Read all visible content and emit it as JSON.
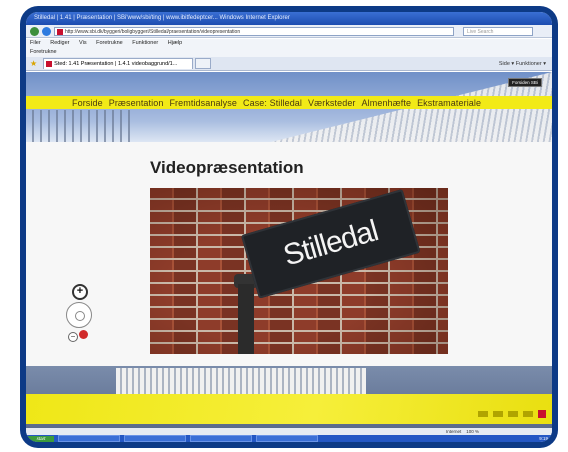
{
  "browser": {
    "title": "Stilledal | 1.41 | Præsentation | SBi'www/sbi/ting | www.ibitfedeptcer... Windows Internet Explorer",
    "address": "http://www.sbi.dk/byggeri/boligbyggeri/Stilledal/praesentation/videopresentation",
    "search_placeholder": "Live Search",
    "menu": [
      "Filer",
      "Rediger",
      "Vis",
      "Foretrukne",
      "Funktioner",
      "Hjælp"
    ],
    "favorites": "Foretrukne",
    "tab_label": "Sted: 1.41 Præsentation | 1.4.1 videobaggrund/1...",
    "command_bar": "Side ▾  Funktioner ▾",
    "status": "Internet",
    "zoom": "100 %"
  },
  "site": {
    "top_button": "Forsiden SBi",
    "nav": [
      "Forside",
      "Præsentation",
      "Fremtidsanalyse",
      "Case: Stilledal",
      "Værksteder",
      "Almenhæfte",
      "Ekstramateriale"
    ]
  },
  "main": {
    "heading": "Videopræsentation",
    "sign_text": "Stilledal"
  },
  "map_controls": {
    "zoom_in": "+",
    "zoom_out": "−"
  },
  "taskbar": {
    "start": "start",
    "clock": "9:19"
  }
}
